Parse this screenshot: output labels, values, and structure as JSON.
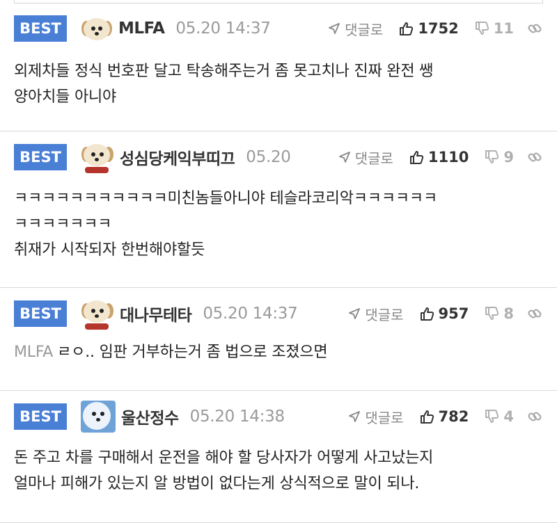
{
  "comments": [
    {
      "badge": "BEST",
      "avatar": "dog-avatar",
      "nickname": "MLFA",
      "time": "05.20 14:37",
      "reply_label": "댓글로",
      "upvotes": "1752",
      "downvotes": "11",
      "text_lines": [
        "외제차들 정식 번호판 달고 탁송해주는거 좀 못고치나 진짜 완전 쌩",
        "양아치들 아니야"
      ]
    },
    {
      "badge": "BEST",
      "avatar": "dog-avatar",
      "nickname": "성심당케익부띠끄",
      "time": "05.20",
      "reply_label": "댓글로",
      "upvotes": "1110",
      "downvotes": "9",
      "text_lines": [
        "ㅋㅋㅋㅋㅋㅋㅋㅋㅋㅋㅋ미친놈들아니야 테슬라코리악ㅋㅋㅋㅋㅋㅋ",
        "ㅋㅋㅋㅋㅋㅋㅋ",
        "취재가 시작되자 한번해야할듯"
      ]
    },
    {
      "badge": "BEST",
      "avatar": "dog-avatar",
      "nickname": "대나무테타",
      "time": "05.20 14:37",
      "reply_label": "댓글로",
      "upvotes": "957",
      "downvotes": "8",
      "mention": "MLFA",
      "text_lines": [
        "ㄹㅇ.. 임판 거부하는거 좀 법으로 조졌으면"
      ]
    },
    {
      "badge": "BEST",
      "avatar": "seal-avatar",
      "nickname": "울산정수",
      "time": "05.20 14:38",
      "reply_label": "댓글로",
      "upvotes": "782",
      "downvotes": "4",
      "text_lines": [
        "돈 주고 차를 구매해서 운전을 해야 할 당사자가 어떻게 사고났는지",
        "얼마나 피해가 있는지 알 방법이 없다는게 상식적으로 말이 되나."
      ]
    }
  ],
  "colors": {
    "badge_bg": "#4a7fd6",
    "muted": "#9a9a9a",
    "text": "#222222"
  }
}
